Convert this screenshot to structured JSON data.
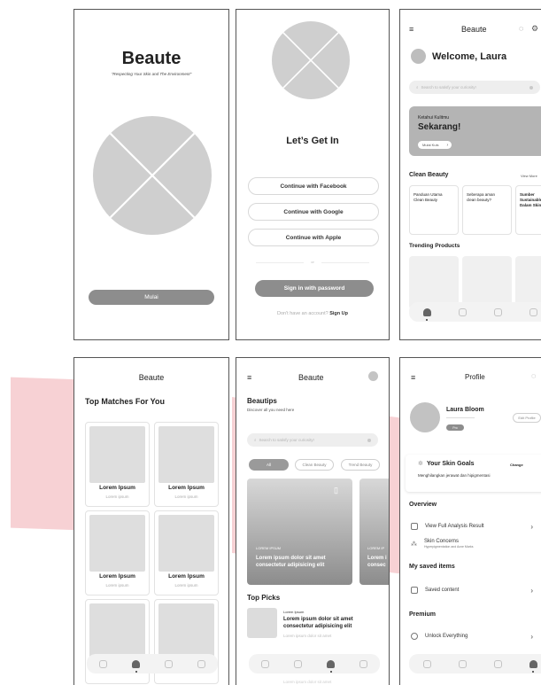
{
  "splash": {
    "title": "Beaute",
    "tagline": "\"Respecting Your Skin and The Environment\"",
    "start_button": "Mulai"
  },
  "login": {
    "heading": "Let’s Get In",
    "facebook_button": "Continue with Facebook",
    "google_button": "Continue with Google",
    "apple_button": "Continue with Apple",
    "divider_text": "or",
    "password_button": "Sign in with password",
    "no_account_text": "Don't have an account?",
    "signup_link": "Sign Up"
  },
  "home": {
    "app_title": "Beaute",
    "menu_icon": "hamburger-icon",
    "welcome": "Welcome, Laura",
    "search_placeholder": "Search to satisfy your curiosity!",
    "banner_small": "Ketahui Kulitmu",
    "banner_big": "Sekarang!",
    "banner_button": "Mulai Kuis",
    "clean_beauty_title": "Clean Beauty",
    "view_more": "View More",
    "clean_cards": [
      "Panduan Utama Clean Beauty",
      "Seberapa aman clean beauty?",
      "Sumber Sustainable Dalam Skin"
    ],
    "trending_title": "Trending Products"
  },
  "matches": {
    "app_title": "Beaute",
    "heading": "Top Matches For You",
    "products": [
      {
        "name": "Lorem Ipsum",
        "sub": "Lorem ipsum"
      },
      {
        "name": "Lorem Ipsum",
        "sub": "Lorem ipsum"
      },
      {
        "name": "Lorem Ipsum",
        "sub": "Lorem ipsum"
      },
      {
        "name": "Lorem Ipsum",
        "sub": "Lorem ipsum"
      }
    ]
  },
  "beautips": {
    "app_title": "Beaute",
    "heading": "Beautips",
    "subheading": "Discover all you need here",
    "search_placeholder": "Search to satisfy your curiosity!",
    "chips": [
      "All",
      "Clean Beauty",
      "Trend Beauty"
    ],
    "article_kicker": "LOREM IPSUM",
    "article_title": "Lorem ipsum dolor sit amet consectetur adipisicing elit",
    "article2_kicker": "LOREM IP",
    "article2_title": "Lorem i consec",
    "top_picks_title": "Top Picks",
    "pick_kicker": "Lorem Ipsum",
    "pick_title": "Lorem ipsum dolor sit amet consectetur adipisicing elit",
    "pick_sub": "Lorem ipsum dolor sit amet",
    "pick2_sub": "Lorem ipsum dolor sit amet"
  },
  "profile": {
    "title": "Profile",
    "name": "Laura Bloom",
    "badge": "Pro",
    "edit_button": "Edit Profile",
    "skin_goals_title": "Your Skin Goals",
    "change_link": "Change",
    "skin_goals_text": "Menghilangkan jerawat dan hipigmentasi",
    "overview_title": "Overview",
    "analysis_item": "View Full Analysis Result",
    "concerns_item": "Skin Concerns",
    "concerns_sub": "Hyperpigmentation and Acne Marks",
    "saved_title": "My saved items",
    "saved_item": "Saved content",
    "premium_title": "Premium",
    "unlock_item": "Unlock Everything"
  },
  "colors": {
    "accent_pink": "#f6c9cd",
    "placeholder_gray": "#cfcfcf",
    "button_gray": "#8d8d8d"
  }
}
